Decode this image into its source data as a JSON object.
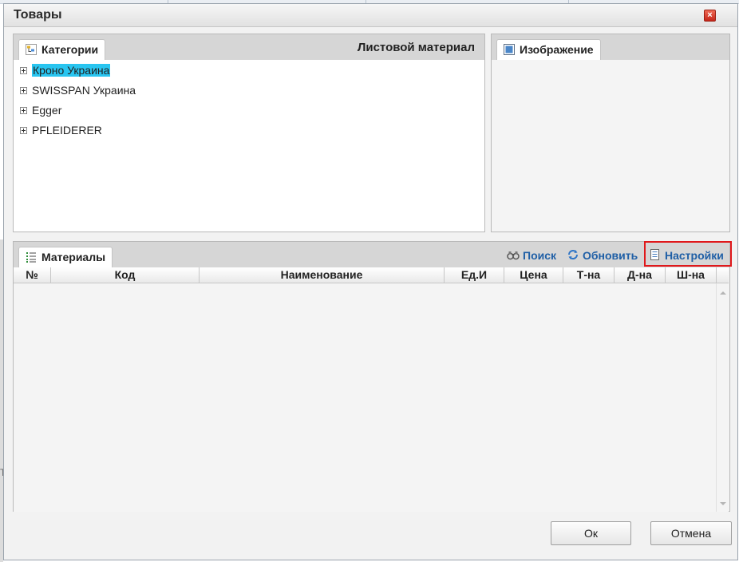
{
  "window": {
    "title": "Товары",
    "close_glyph": "×"
  },
  "categories": {
    "tab_label": "Категории",
    "heading": "Листовой материал",
    "items": [
      {
        "label": "Кроно Украина"
      },
      {
        "label": "SWISSPAN Украина"
      },
      {
        "label": "Egger"
      },
      {
        "label": "PFLEIDERER"
      }
    ]
  },
  "image_panel": {
    "tab_label": "Изображение"
  },
  "materials": {
    "tab_label": "Материалы",
    "toolbar": {
      "search_label": "Поиск",
      "refresh_label": "Обновить",
      "settings_label": "Настройки"
    },
    "columns": [
      "№",
      "Код",
      "Наименование",
      "Ед.И",
      "Цена",
      "Т-на",
      "Д-на",
      "Ш-на"
    ]
  },
  "buttons": {
    "ok_label": "Ок",
    "cancel_label": "Отмена"
  },
  "edge_glyph": "Т",
  "colors": {
    "selection": "#29c5f0",
    "link": "#1f5fa6",
    "highlight_border": "#e0181b",
    "close_button": "#d7362a"
  }
}
